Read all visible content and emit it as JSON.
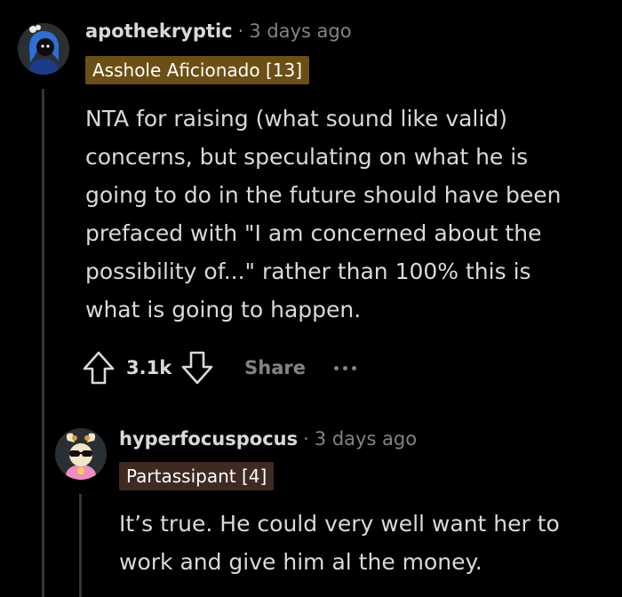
{
  "comments": [
    {
      "username": "apothekryptic",
      "separator": "·",
      "timestamp": "3 days ago",
      "flair": "Asshole Aficionado [13]",
      "body_lines": [
        "NTA for raising (what sound like valid)",
        "concerns, but speculating on what he is",
        "going to do in the future should have been",
        "prefaced with \"I am concerned about the",
        "possibility of...\" rather than 100% this is",
        "what is going to happen."
      ],
      "score": "3.1k",
      "share_label": "Share",
      "flair_color": "#6b4f15"
    },
    {
      "username": "hyperfocuspocus",
      "separator": "·",
      "timestamp": "3 days ago",
      "flair": "Partassipant [4]",
      "body_lines": [
        "It’s true. He could very well want her to",
        "work and give him al the money."
      ],
      "flair_color": "#3f2a22"
    }
  ],
  "icons": {
    "upvote": "upvote-arrow-icon",
    "downvote": "downvote-arrow-icon",
    "more": "more-dots-icon"
  }
}
